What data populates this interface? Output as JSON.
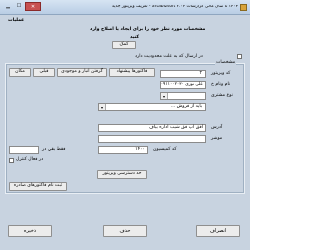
{
  "window": {
    "title": "۱۴۰۳ تا سال مالی گزارشات artabizsoft ۲.۰۴ - تعریف ویزیتور جدید",
    "controls": {
      "minimize": "▁",
      "maximize": "☐",
      "close": "✕"
    }
  },
  "header": {
    "section_label": "عملیات",
    "instruction_line1": "مشخصات مورد نظر خود را برای ایجاد یا اصلاح وارد",
    "instruction_line2": "کنید",
    "help_button": "کمک"
  },
  "check_limited": {
    "label": "در ارسال که به علت محدودیت دارد"
  },
  "group": {
    "title": "مشخصات",
    "buttons": {
      "map": "مکان",
      "previous": "قبلی",
      "store": "گرفتن انبار و موجودی",
      "invoice": "فاکتورها پیشنهاد"
    },
    "visitor_code": {
      "label": "کد ویزیتور",
      "value": "۲"
    },
    "name": {
      "label": "نام ونام خ",
      "value": "علی نوری ۰۹۱۱۰۰۲۰۳۰"
    },
    "customer_type": {
      "label": "نوع مشتری",
      "value": ""
    },
    "sale_line": {
      "text": "باید از فروش ..."
    },
    "address": {
      "label": "آدرس",
      "value": "افق اپ فق شیب اداره بیاف"
    },
    "notes": {
      "label": "موشر",
      "value": ""
    },
    "commission": {
      "label": "کد کمیسیون",
      "value": "۱۴۰۰"
    },
    "remain_label": "فقط بقي در",
    "check_active": "در فعال کنترل",
    "route_button": "حد دسترسی ویزیتور",
    "excel_button": "ثبت نام فاکتورهای صادره"
  },
  "footer": {
    "save": "ذخیره",
    "delete": "حذف",
    "cancel": "انصراف"
  }
}
